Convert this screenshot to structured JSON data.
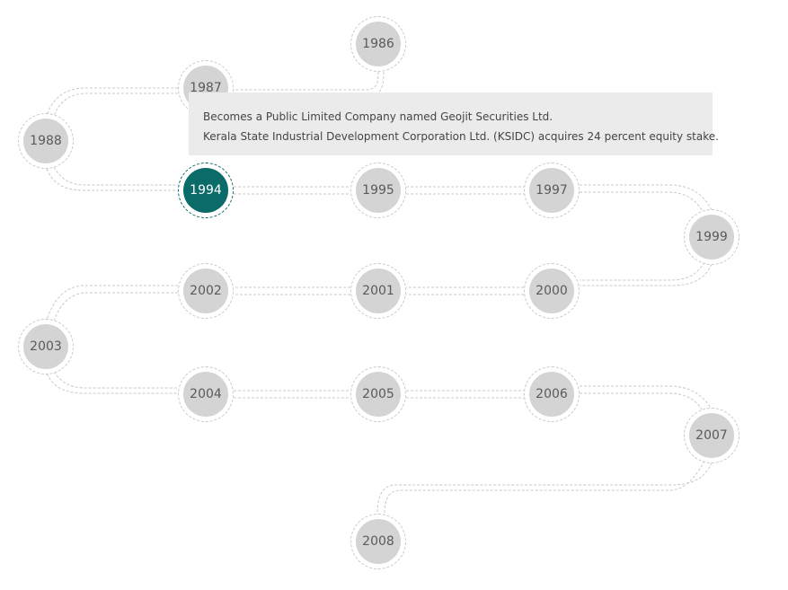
{
  "timeline": {
    "active_year": "1994",
    "years": [
      "1986",
      "1987",
      "1988",
      "1994",
      "1995",
      "1997",
      "1999",
      "2000",
      "2001",
      "2002",
      "2003",
      "2004",
      "2005",
      "2006",
      "2007",
      "2008"
    ]
  },
  "tooltip": {
    "lines": [
      "Becomes a Public Limited Company named Geojit Securities Ltd.",
      "Kerala State Industrial Development Corporation Ltd. (KSIDC) acquires 24 percent equity stake."
    ]
  },
  "colors": {
    "active": "#0b6b68",
    "node": "#d4d4d4",
    "tooltip_bg": "#ebebeb"
  }
}
